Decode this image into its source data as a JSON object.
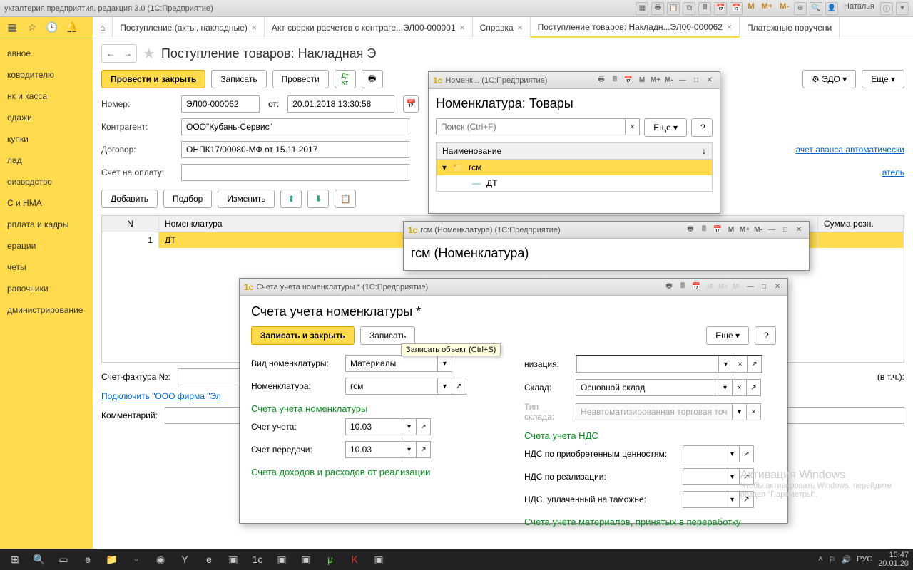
{
  "titlebar": {
    "title": "ухгалтерия предприятия, редакция 3.0  (1С:Предприятие)",
    "m": "M",
    "mp": "M+",
    "mm": "M-",
    "user": "Наталья"
  },
  "tabs": {
    "home": "⌂",
    "t1": "Поступление (акты, накладные)",
    "t2": "Акт сверки расчетов с контраге...ЭЛ00-000001",
    "t3": "Справка",
    "t4": "Поступление товаров: Накладн...ЭЛ00-000062",
    "t5": "Платежные поручени"
  },
  "sidebar": {
    "i1": "авное",
    "i2": "ководителю",
    "i3": "нк и касса",
    "i4": "одажи",
    "i5": "купки",
    "i6": "лад",
    "i7": "оизводство",
    "i8": "С и НМА",
    "i9": "рплата и кадры",
    "i10": "ерации",
    "i11": "четы",
    "i12": "равочники",
    "i13": "дминистрирование"
  },
  "doc": {
    "title": "Поступление товаров: Накладная Э",
    "btn_post_close": "Провести и закрыть",
    "btn_write": "Записать",
    "btn_post": "Провести",
    "btn_edo": "ЭДО",
    "btn_more": "Еще",
    "lbl_num": "Номер:",
    "val_num": "ЭЛ00-000062",
    "lbl_from": "от:",
    "val_date": "20.01.2018 13:30:58",
    "lbl_contr": "Контрагент:",
    "val_contr": "ООО\"Кубань-Сервис\"",
    "lbl_dogovor": "Договор:",
    "val_dogovor": "ОНПК17/00080-МФ от 15.11.2017",
    "lbl_schet": "Счет на оплату:",
    "link_avans": "ачет аванса автоматически",
    "link_atel": "атель",
    "btn_add": "Добавить",
    "btn_podbor": "Подбор",
    "btn_change": "Изменить",
    "col_n": "N",
    "col_nom": "Номенклатура",
    "col_sum": "Сумма розн.",
    "row1_n": "1",
    "row1_nom": "ДТ",
    "lbl_sf": "Счет-фактура №:",
    "link_podkl": "Подключить \"ООО фирма \"Эл",
    "lbl_comment": "Комментарий:",
    "vtch": "(в т.ч.):"
  },
  "modal_nom": {
    "tb": "Номенк...   (1С:Предприятие)",
    "title": "Номенклатура: Товары",
    "search_ph": "Поиск (Ctrl+F)",
    "btn_more": "Еще",
    "col_name": "Наименование",
    "item1": "гсм",
    "item2": "ДТ",
    "m": "M",
    "mp": "M+",
    "mm": "M-"
  },
  "modal_gsm": {
    "tb": "гсм (Номенклатура)  (1С:Предприятие)",
    "title": "гсм (Номенклатура)",
    "m": "M",
    "mp": "M+",
    "mm": "M-"
  },
  "modal_acc": {
    "tb": "Счета учета номенклатуры *  (1С:Предприятие)",
    "title": "Счета учета номенклатуры *",
    "btn_write_close": "Записать и закрыть",
    "btn_write": "Записать",
    "btn_more": "Еще",
    "tooltip": "Записать объект (Ctrl+S)",
    "lbl_vid": "Вид номенклатуры:",
    "val_vid": "Материалы",
    "lbl_org_suffix": "низация:",
    "lbl_nom": "Номенклатура:",
    "val_nom": "гсм",
    "lbl_sklad": "Склад:",
    "val_sklad": "Основной склад",
    "lbl_tip": "Тип склада:",
    "val_tip": "Неавтоматизированная торговая точка",
    "sec1": "Счета учета номенклатуры",
    "lbl_schet_ucheta": "Счет учета:",
    "val_schet_ucheta": "10.03",
    "lbl_schet_per": "Счет передачи:",
    "val_schet_per": "10.03",
    "sec2": "Счета учета НДС",
    "lbl_nds_priobr": "НДС по приобретенным ценностям:",
    "lbl_nds_real": "НДС по реализации:",
    "lbl_nds_tam": "НДС, уплаченный на таможне:",
    "sec3": "Счета доходов и расходов от реализации",
    "sec4": "Счета учета материалов, принятых в переработку",
    "m": "M",
    "mp": "M+",
    "mm": "M-"
  },
  "watermark": {
    "l1": "Активация Windows",
    "l2": "Чтобы активировать Windows, перейдите",
    "l3": "раздел \"Параметры\"."
  },
  "taskbar": {
    "lang": "РУС",
    "time": "15:47",
    "date": "20.01.20"
  }
}
